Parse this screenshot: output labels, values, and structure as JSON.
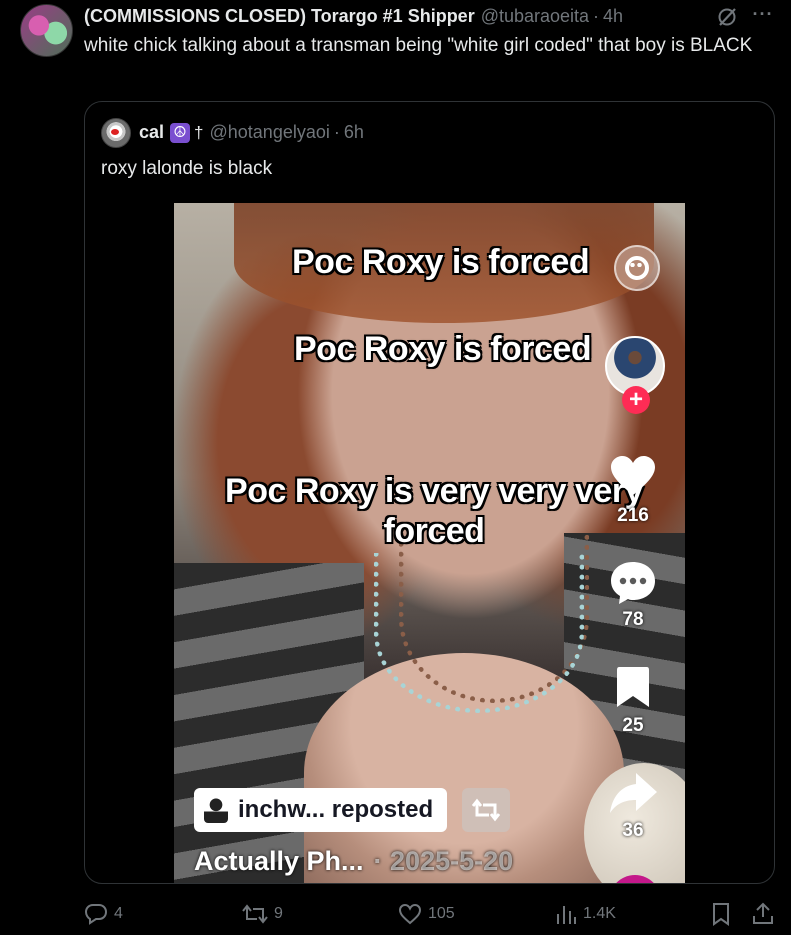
{
  "post": {
    "display_name": "(COMMISSIONS CLOSED) Torargo #1 Shipper",
    "handle": "@tubaraoeita",
    "separator": "·",
    "time": "4h",
    "text": "white chick talking about a transman being \"white girl coded\" that boy is BLACK",
    "icons": [
      "grok-icon",
      "more-icon"
    ],
    "more_label": "···"
  },
  "quote": {
    "display_name": "cal",
    "badge_peace": "☮",
    "badge_cross": "†",
    "handle": "@hotangelyaoi",
    "separator": "·",
    "time": "6h",
    "text": "roxy lalonde is black"
  },
  "video": {
    "overlay_1": "Poc Roxy is forced",
    "overlay_2": "Poc Roxy is forced",
    "overlay_3": "Poc Roxy is very very very forced",
    "likes": "216",
    "comments": "78",
    "saves": "25",
    "shares": "36",
    "follow_label": "+",
    "repost_label": "inchw... reposted",
    "caption_user": "Actually Ph...",
    "caption_date": "· 2025-5-20",
    "colors": {
      "follow": "#fe2c55",
      "disc": "#c4188a"
    }
  },
  "actions": {
    "replies": "4",
    "reposts": "9",
    "likes": "105",
    "views": "1.4K",
    "icons": [
      "reply-icon",
      "repost-icon",
      "like-icon",
      "views-icon",
      "bookmark-icon",
      "share-icon"
    ]
  },
  "colors": {
    "background": "#000000",
    "text": "#e7e9ea",
    "muted": "#71767b",
    "border": "#2f3336"
  }
}
